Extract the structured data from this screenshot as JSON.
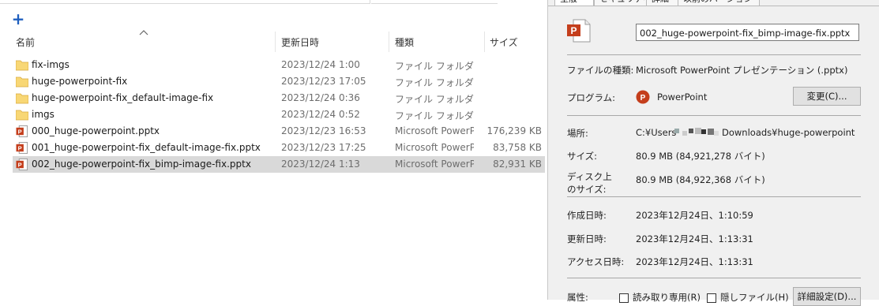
{
  "explorer": {
    "new_label": "+",
    "columns": {
      "name": "名前",
      "date": "更新日時",
      "type": "種類",
      "size": "サイズ"
    },
    "rows": [
      {
        "icon": "folder-icon",
        "name": "fix-imgs",
        "date": "2023/12/24 1:00",
        "type": "ファイル フォルダー",
        "size": ""
      },
      {
        "icon": "folder-icon",
        "name": "huge-powerpoint-fix",
        "date": "2023/12/23 17:05",
        "type": "ファイル フォルダー",
        "size": ""
      },
      {
        "icon": "folder-icon",
        "name": "huge-powerpoint-fix_default-image-fix",
        "date": "2023/12/24 0:36",
        "type": "ファイル フォルダー",
        "size": ""
      },
      {
        "icon": "folder-icon",
        "name": "imgs",
        "date": "2023/12/24 0:52",
        "type": "ファイル フォルダー",
        "size": ""
      },
      {
        "icon": "pptx-file-icon",
        "name": "000_huge-powerpoint.pptx",
        "date": "2023/12/23 16:53",
        "type": "Microsoft PowerP...",
        "size": "176,239 KB"
      },
      {
        "icon": "pptx-file-icon",
        "name": "001_huge-powerpoint-fix_default-image-fix.pptx",
        "date": "2023/12/23 17:25",
        "type": "Microsoft PowerP...",
        "size": "83,758 KB"
      },
      {
        "icon": "pptx-file-icon",
        "name": "002_huge-powerpoint-fix_bimp-image-fix.pptx",
        "date": "2023/12/24 1:13",
        "type": "Microsoft PowerP...",
        "size": "82,931 KB",
        "selected": true
      }
    ]
  },
  "properties": {
    "tabs": [
      "全般",
      "セキュリティ",
      "詳細",
      "以前のバージョン"
    ],
    "filename": "002_huge-powerpoint-fix_bimp-image-fix.pptx",
    "file_type_label": "ファイルの種類:",
    "file_type_value": "Microsoft PowerPoint プレゼンテーション (.pptx)",
    "program_label": "プログラム:",
    "program_value": "PowerPoint",
    "change_button": "変更(C)...",
    "location_label": "場所:",
    "location_prefix": "C:¥Users",
    "location_suffix": "Downloads¥huge-powerpoint",
    "size_label": "サイズ:",
    "size_value": "80.9 MB (84,921,278 バイト)",
    "disk_size_label_1": "ディスク上",
    "disk_size_label_2": "のサイズ:",
    "disk_size_value": "80.9 MB (84,922,368 バイト)",
    "created_label": "作成日時:",
    "created_value": "2023年12月24日、1:10:59",
    "modified_label": "更新日時:",
    "modified_value": "2023年12月24日、1:13:31",
    "accessed_label": "アクセス日時:",
    "accessed_value": "2023年12月24日、1:13:31",
    "attributes_label": "属性:",
    "readonly_label": "読み取り専用(R)",
    "hidden_label": "隠しファイル(H)",
    "advanced_button": "詳細設定(D)..."
  },
  "colors": {
    "accent": "#1f5fbf",
    "selected_row": "#d9d9d9",
    "ppt_red": "#c43e1c",
    "folder": "#f8d775"
  }
}
